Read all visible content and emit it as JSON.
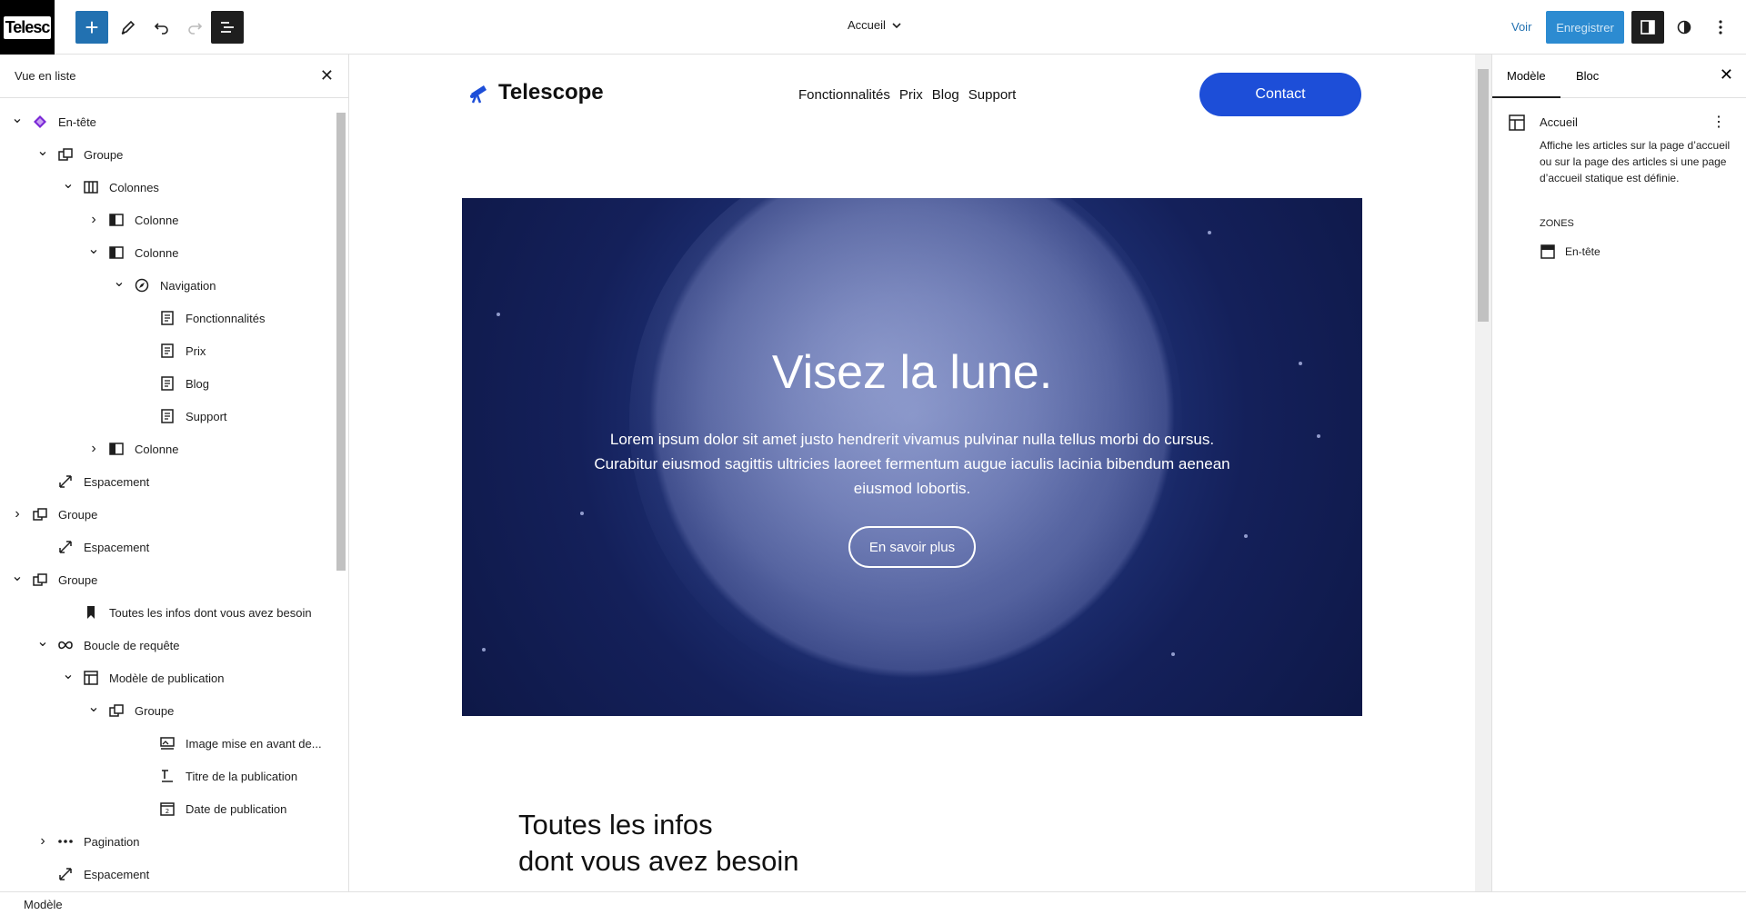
{
  "topbar": {
    "site_logo_text": "Telesc",
    "document_title": "Accueil",
    "view_label": "Voir",
    "save_label": "Enregistrer"
  },
  "listview": {
    "title": "Vue en liste",
    "items": [
      {
        "label": "En-tête",
        "depth": 0,
        "chevron": "down",
        "icon": "template-part-icon"
      },
      {
        "label": "Groupe",
        "depth": 1,
        "chevron": "down",
        "icon": "group-icon"
      },
      {
        "label": "Colonnes",
        "depth": 2,
        "chevron": "down",
        "icon": "columns-icon"
      },
      {
        "label": "Colonne",
        "depth": 3,
        "chevron": "right",
        "icon": "column-icon"
      },
      {
        "label": "Colonne",
        "depth": 3,
        "chevron": "down",
        "icon": "column-icon"
      },
      {
        "label": "Navigation",
        "depth": 4,
        "chevron": "down",
        "icon": "navigation-icon"
      },
      {
        "label": "Fonctionnalités",
        "depth": 5,
        "chevron": "",
        "icon": "page-icon"
      },
      {
        "label": "Prix",
        "depth": 5,
        "chevron": "",
        "icon": "page-icon"
      },
      {
        "label": "Blog",
        "depth": 5,
        "chevron": "",
        "icon": "page-icon"
      },
      {
        "label": "Support",
        "depth": 5,
        "chevron": "",
        "icon": "page-icon"
      },
      {
        "label": "Colonne",
        "depth": 3,
        "chevron": "right",
        "icon": "column-icon"
      },
      {
        "label": "Espacement",
        "depth": 1,
        "chevron": "",
        "icon": "spacer-icon"
      },
      {
        "label": "Groupe",
        "depth": 0,
        "chevron": "right",
        "icon": "group-icon"
      },
      {
        "label": "Espacement",
        "depth": 1,
        "chevron": "",
        "icon": "spacer-icon"
      },
      {
        "label": "Groupe",
        "depth": 0,
        "chevron": "down",
        "icon": "group-icon"
      },
      {
        "label": "Toutes les infos dont vous avez besoin",
        "depth": 2,
        "chevron": "",
        "icon": "heading-bookmark-icon"
      },
      {
        "label": "Boucle de requête",
        "depth": 1,
        "chevron": "down",
        "icon": "loop-icon"
      },
      {
        "label": "Modèle de publication",
        "depth": 2,
        "chevron": "down",
        "icon": "post-template-icon"
      },
      {
        "label": "Groupe",
        "depth": 3,
        "chevron": "down",
        "icon": "group-icon"
      },
      {
        "label": "Image mise en avant de...",
        "depth": 5,
        "chevron": "",
        "icon": "featured-image-icon"
      },
      {
        "label": "Titre de la publication",
        "depth": 5,
        "chevron": "",
        "icon": "post-title-icon"
      },
      {
        "label": "Date de publication",
        "depth": 5,
        "chevron": "",
        "icon": "post-date-icon"
      },
      {
        "label": "Pagination",
        "depth": 1,
        "chevron": "right",
        "icon": "pagination-icon"
      },
      {
        "label": "Espacement",
        "depth": 1,
        "chevron": "",
        "icon": "spacer-icon"
      }
    ]
  },
  "canvas": {
    "brand": "Telescope",
    "nav": [
      "Fonctionnalités",
      "Prix",
      "Blog",
      "Support"
    ],
    "contact_label": "Contact",
    "hero_title": "Visez la lune.",
    "hero_text": "Lorem ipsum dolor sit amet justo hendrerit vivamus pulvinar nulla tellus morbi do cursus. Curabitur eiusmod sagittis ultricies laoreet fermentum augue iaculis lacinia bibendum aenean eiusmod lobortis.",
    "hero_button": "En savoir plus",
    "section_title_line1": "Toutes les infos",
    "section_title_line2": "dont vous avez besoin"
  },
  "settings": {
    "tab_template": "Modèle",
    "tab_block": "Bloc",
    "template_name": "Accueil",
    "template_description": "Affiche les articles sur la page d’accueil ou sur la page des articles si une page d’accueil statique est définie.",
    "zones_label": "ZONES",
    "zone_item": "En-tête"
  },
  "footer": {
    "breadcrumb": "Modèle"
  },
  "colors": {
    "accent": "#2271b1",
    "contact_button": "#1d4ed8",
    "hero_background": "#14205a"
  }
}
